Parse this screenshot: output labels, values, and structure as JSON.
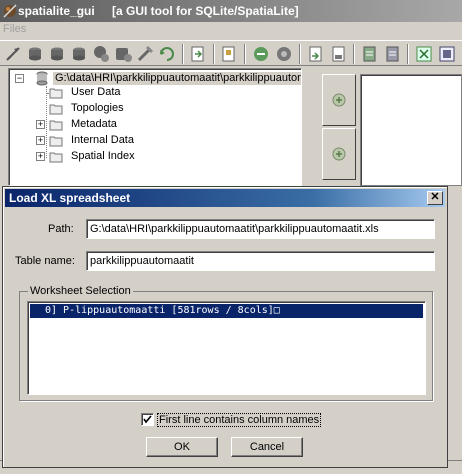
{
  "app": {
    "title": "spatialite_gui",
    "subtitle": "[a GUI tool for SQLite/SpatiaLite]"
  },
  "menu": {
    "files": "Files"
  },
  "toolbar": {
    "icons": [
      "connect-db-icon",
      "create-db-icon",
      "create-memory-db-icon",
      "disconnect-db-icon",
      "memory-db-load-icon",
      "memory-db-save-icon",
      "vacuum-icon",
      "execute-sql-icon",
      "load-shapefile-icon",
      "virtual-shapefile-icon",
      "srid-search-icon",
      "char-encoding-icon",
      "load-xl-icon",
      "virtual-xl-icon",
      "dump-icon",
      "export-icon",
      "help-icon",
      "about-icon"
    ]
  },
  "tree": {
    "root_label": "G:\\data\\HRI\\parkkilippuautomaatit\\parkkilippuautom",
    "nodes": [
      {
        "label": "User Data",
        "expandable": false
      },
      {
        "label": "Topologies",
        "expandable": false
      },
      {
        "label": "Metadata",
        "expandable": true
      },
      {
        "label": "Internal Data",
        "expandable": true
      },
      {
        "label": "Spatial Index",
        "expandable": true
      }
    ]
  },
  "dialog": {
    "title": "Load XL spreadsheet",
    "close_symbol": "✕",
    "path_label": "Path:",
    "path_value": "G:\\data\\HRI\\parkkilippuautomaatit\\parkkilippuautomaatit.xls",
    "table_label": "Table name:",
    "table_value": "parkkilippuautomaatit",
    "worksheet_group": "Worksheet Selection",
    "worksheets": [
      "0] P-lippuautomaatti [581rows / 8cols]□"
    ],
    "first_line_label": "First line contains column names",
    "first_line_checked": true,
    "ok_label": "OK",
    "cancel_label": "Cancel"
  },
  "colors": {
    "selection": "#0a246a",
    "window_bg": "#d4d0c8",
    "title_active": "#0a246a",
    "title_inactive": "#808080"
  }
}
